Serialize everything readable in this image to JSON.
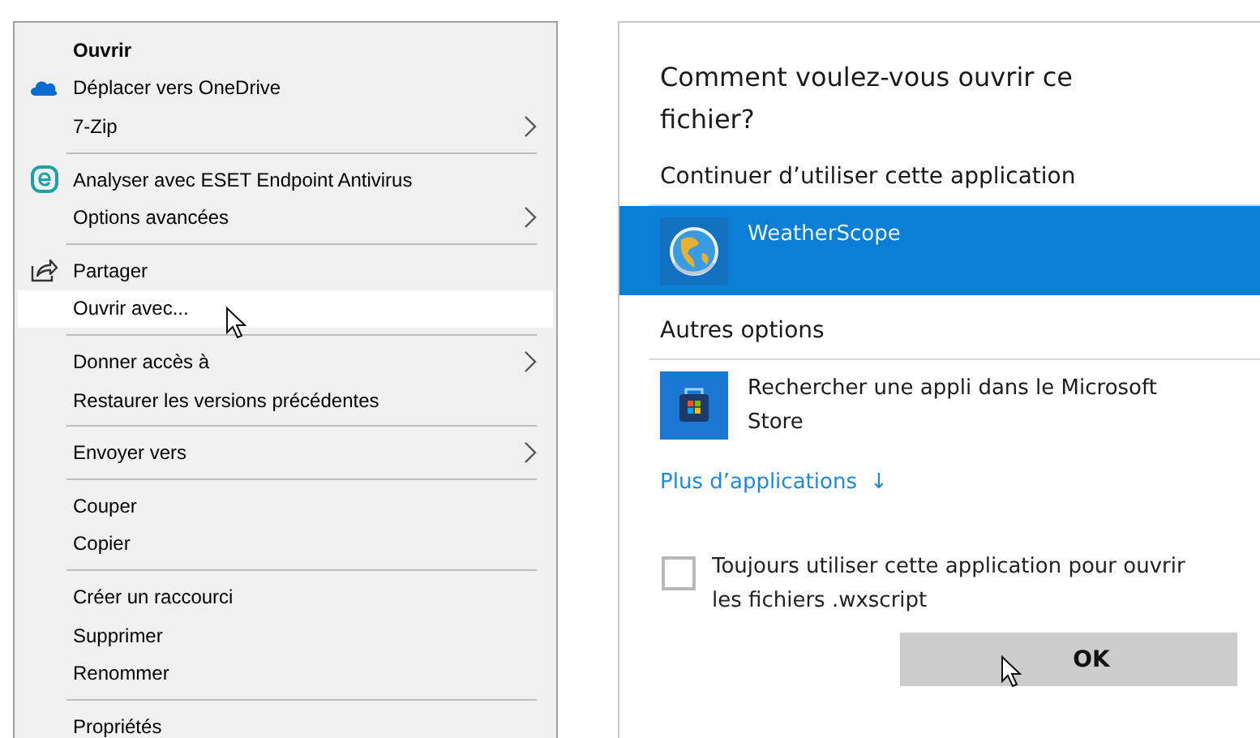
{
  "context_menu": {
    "items": [
      {
        "kind": "item",
        "label": "Ouvrir",
        "bold": true,
        "submenu": false,
        "hovered": false
      },
      {
        "kind": "cloud",
        "label": "Déplacer vers OneDrive",
        "bold": false,
        "submenu": false,
        "hovered": false
      },
      {
        "kind": "item",
        "label": "7-Zip",
        "bold": false,
        "submenu": true,
        "hovered": false
      },
      {
        "kind": "separator"
      },
      {
        "kind": "eset",
        "label": "Analyser avec ESET Endpoint Antivirus",
        "bold": false,
        "submenu": false,
        "hovered": false
      },
      {
        "kind": "item",
        "label": "Options avancées",
        "bold": false,
        "submenu": true,
        "hovered": false
      },
      {
        "kind": "separator"
      },
      {
        "kind": "share",
        "label": "Partager",
        "bold": false,
        "submenu": false,
        "hovered": false
      },
      {
        "kind": "item",
        "label": "Ouvrir avec...",
        "bold": false,
        "submenu": false,
        "hovered": true
      },
      {
        "kind": "separator"
      },
      {
        "kind": "item",
        "label": "Donner accès à",
        "bold": false,
        "submenu": true,
        "hovered": false
      },
      {
        "kind": "item",
        "label": "Restaurer les versions précédentes",
        "bold": false,
        "submenu": false,
        "hovered": false
      },
      {
        "kind": "separator"
      },
      {
        "kind": "item",
        "label": "Envoyer vers",
        "bold": false,
        "submenu": true,
        "hovered": false
      },
      {
        "kind": "separator"
      },
      {
        "kind": "item",
        "label": "Couper",
        "bold": false,
        "submenu": false,
        "hovered": false
      },
      {
        "kind": "item",
        "label": "Copier",
        "bold": false,
        "submenu": false,
        "hovered": false
      },
      {
        "kind": "separator"
      },
      {
        "kind": "item",
        "label": "Créer un raccourci",
        "bold": false,
        "submenu": false,
        "hovered": false
      },
      {
        "kind": "item",
        "label": "Supprimer",
        "bold": false,
        "submenu": false,
        "hovered": false
      },
      {
        "kind": "item",
        "label": "Renommer",
        "bold": false,
        "submenu": false,
        "hovered": false
      },
      {
        "kind": "separator"
      },
      {
        "kind": "item",
        "label": "Propriétés",
        "bold": false,
        "submenu": false,
        "hovered": false
      }
    ]
  },
  "open_with_dialog": {
    "title": "Comment voulez-vous ouvrir ce fichier?",
    "sections": [
      {
        "heading": "Continuer d’utiliser cette application",
        "apps": [
          {
            "kind": "installed",
            "name": "WeatherScope",
            "selected": true
          }
        ]
      },
      {
        "heading": "Autres options",
        "apps": [
          {
            "kind": "store",
            "name": "Rechercher une appli dans le Microsoft Store",
            "selected": false
          }
        ]
      }
    ],
    "more_link": "Plus d’applications",
    "more_arrow": "↓",
    "always_use": {
      "label": "Toujours utiliser cette application pour ouvrir les fichiers .wxscript",
      "checked": false
    },
    "ok_button": "OK"
  }
}
